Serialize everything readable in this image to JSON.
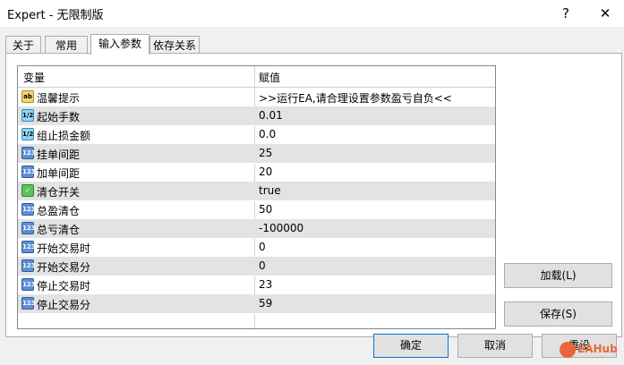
{
  "window": {
    "title": "Expert - 无限制版",
    "help": "?",
    "close": "✕"
  },
  "tabs": [
    {
      "label": "关于"
    },
    {
      "label": "常用"
    },
    {
      "label": "输入参数"
    },
    {
      "label": "依存关系"
    }
  ],
  "grid": {
    "col_variable": "变量",
    "col_value": "赋值",
    "rows": [
      {
        "icon": "ab",
        "type": "string",
        "name": "温馨提示",
        "value": ">>运行EA,请合理设置参数盈亏自负<<"
      },
      {
        "icon": "1/2",
        "type": "double",
        "name": "起始手数",
        "value": "0.01"
      },
      {
        "icon": "1/2",
        "type": "double",
        "name": "组止损金额",
        "value": "0.0"
      },
      {
        "icon": "123",
        "type": "int",
        "name": "挂单间距",
        "value": "25"
      },
      {
        "icon": "123",
        "type": "int",
        "name": "加单间距",
        "value": "20"
      },
      {
        "icon": "✓",
        "type": "bool",
        "name": "清仓开关",
        "value": "true"
      },
      {
        "icon": "123",
        "type": "int",
        "name": "总盈清仓",
        "value": "50"
      },
      {
        "icon": "123",
        "type": "int",
        "name": "总亏清仓",
        "value": "-100000"
      },
      {
        "icon": "123",
        "type": "int",
        "name": "开始交易时",
        "value": "0"
      },
      {
        "icon": "123",
        "type": "int",
        "name": "开始交易分",
        "value": "0"
      },
      {
        "icon": "123",
        "type": "int",
        "name": "停止交易时",
        "value": "23"
      },
      {
        "icon": "123",
        "type": "int",
        "name": "停止交易分",
        "value": "59"
      }
    ]
  },
  "buttons": {
    "load": "加载(L)",
    "save": "保存(S)",
    "ok": "确定",
    "cancel": "取消",
    "reset": "重设"
  },
  "watermark": "EAHub"
}
